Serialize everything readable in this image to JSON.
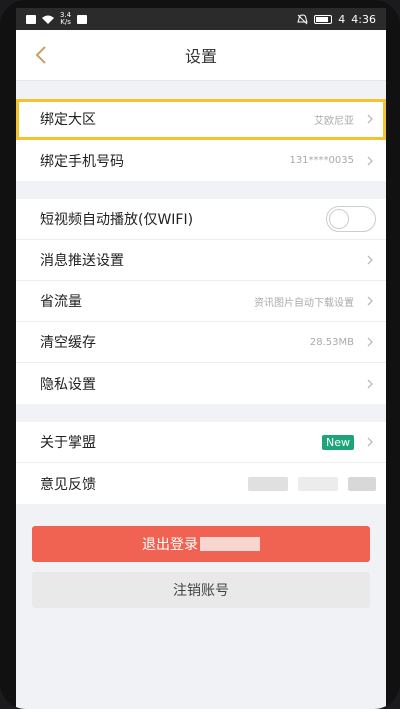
{
  "status_bar": {
    "speed": "3.4",
    "speed_unit": "K/s",
    "battery": "4",
    "time": "4:36"
  },
  "nav": {
    "title": "设置",
    "back_icon": "chevron-left-icon"
  },
  "group1": [
    {
      "label": "绑定大区",
      "value": "艾欧尼亚",
      "highlighted": true
    },
    {
      "label": "绑定手机号码",
      "value": "131****0035"
    }
  ],
  "group2": {
    "autoplay_label": "短视频自动播放(仅WIFI)",
    "autoplay_on": false,
    "push_label": "消息推送设置",
    "traffic_label": "省流量",
    "traffic_value": "资讯图片自动下载设置",
    "cache_label": "清空缓存",
    "cache_value": "28.53MB",
    "privacy_label": "隐私设置"
  },
  "group3": {
    "about_label": "关于掌盟",
    "about_badge": "New",
    "feedback_label": "意见反馈"
  },
  "actions": {
    "logout_label": "退出登录",
    "cancel_account_label": "注销账号"
  },
  "colors": {
    "accent": "#f06352",
    "highlight": "#f4c430",
    "badge": "#1da57a",
    "back_icon": "#c9a063"
  }
}
